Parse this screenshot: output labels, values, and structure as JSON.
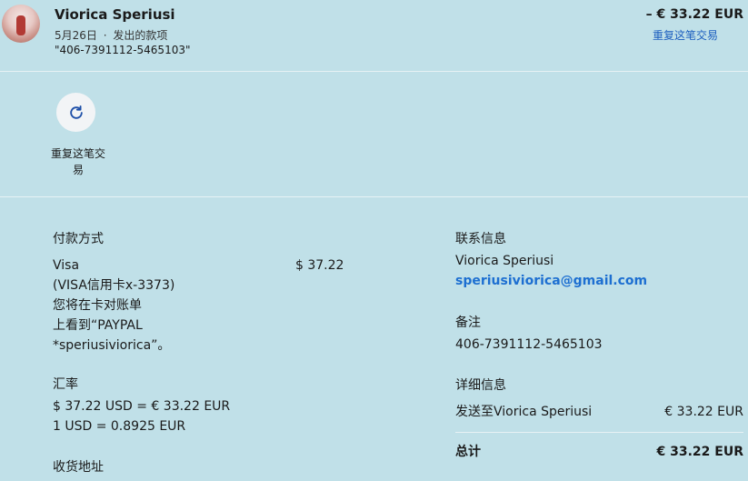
{
  "header": {
    "name": "Viorica Speriusi",
    "date": "5月26日",
    "dot": "·",
    "type": "发出的款项",
    "reference": "\"406-7391112-5465103\"",
    "amount": "– € 33.22 EUR",
    "repeat_link": "重复这笔交易"
  },
  "actions": {
    "repeat_label_line1": "重复这笔交",
    "repeat_label_line2": "易"
  },
  "payment": {
    "heading": "付款方式",
    "method": "Visa",
    "card": "(VISA信用卡x-3373)",
    "note_line1": "您将在卡对账单",
    "note_line2": "上看到“PAYPAL",
    "note_line3": "*speriusiviorica”。",
    "amount": "$ 37.22"
  },
  "exchange": {
    "heading": "汇率",
    "line1": "$ 37.22 USD = € 33.22 EUR",
    "line2": "1 USD = 0.8925 EUR"
  },
  "shipping": {
    "heading": "收货地址"
  },
  "contact": {
    "heading": "联系信息",
    "name": "Viorica Speriusi",
    "email": "speriusiviorica@gmail.com"
  },
  "notes": {
    "heading": "备注",
    "value": "406-7391112-5465103"
  },
  "details": {
    "heading": "详细信息",
    "sent_to_label": "发送至Viorica Speriusi",
    "sent_to_amount": "€ 33.22 EUR",
    "total_label": "总计",
    "total_amount": "€ 33.22 EUR"
  }
}
